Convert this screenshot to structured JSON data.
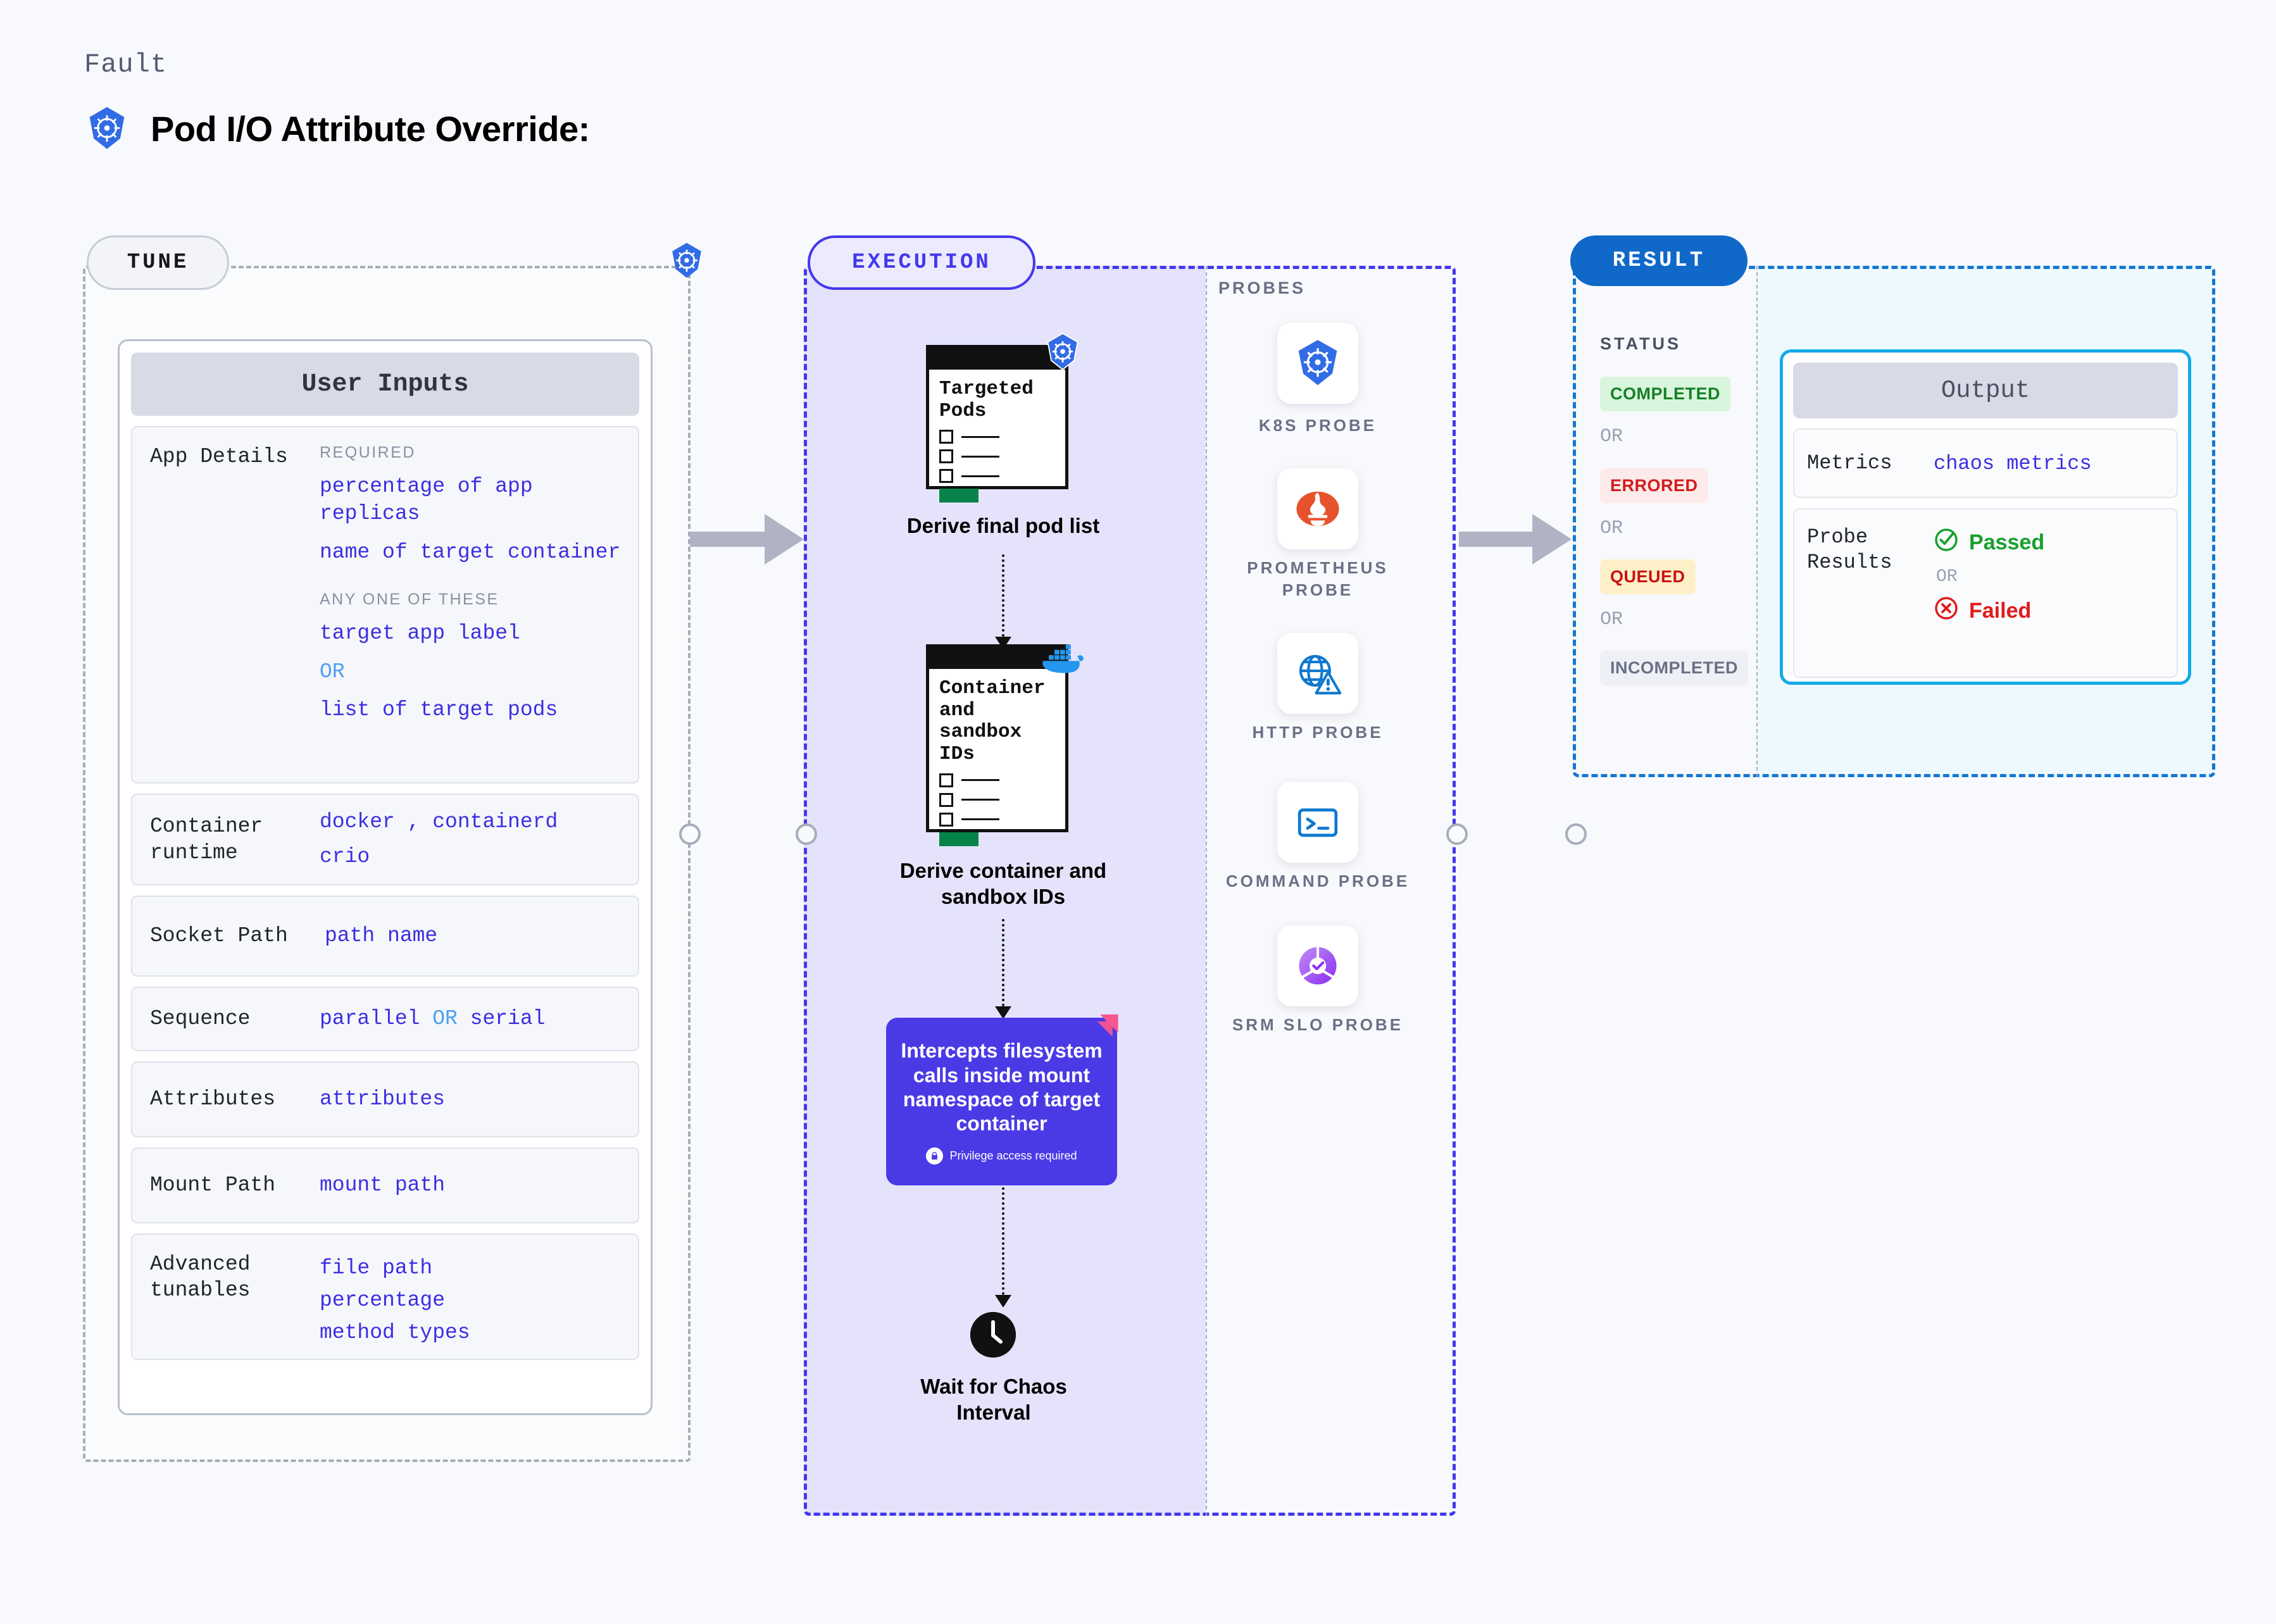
{
  "header": {
    "kicker": "Fault",
    "title": "Pod I/O Attribute Override:",
    "icon": "kubernetes-icon"
  },
  "tune": {
    "pill_label": "TUNE",
    "edge_icon": "kubernetes-icon",
    "card_title": "User Inputs",
    "rows": [
      {
        "label": "App Details",
        "groups": [
          {
            "heading": "REQUIRED",
            "values": [
              "percentage of app replicas",
              "name of target container"
            ]
          },
          {
            "heading": "ANY ONE OF THESE",
            "values": [
              "target app label",
              "OR",
              "list of target pods"
            ]
          }
        ]
      },
      {
        "label": "Container runtime",
        "values": [
          "docker , containerd",
          "crio"
        ]
      },
      {
        "label": "Socket Path",
        "values": [
          "path name"
        ]
      },
      {
        "label": "Sequence",
        "values": [
          "parallel OR serial"
        ]
      },
      {
        "label": "Attributes",
        "values": [
          "attributes"
        ]
      },
      {
        "label": "Mount Path",
        "values": [
          "mount path"
        ]
      },
      {
        "label": "Advanced tunables",
        "values": [
          "file path",
          "percentage",
          "method types"
        ]
      }
    ]
  },
  "execution": {
    "pill_label": "EXECUTION",
    "steps": [
      {
        "doc_title": "Targeted Pods",
        "caption": "Derive final pod list",
        "badge_icon": "kubernetes-icon"
      },
      {
        "doc_title": "Container and sandbox IDs",
        "caption": "Derive container and sandbox IDs",
        "badge_icon": "docker-icon"
      }
    ],
    "intercept": {
      "text": "Intercepts filesystem calls inside mount namespace of target container",
      "note": "Privilege access required",
      "note_icon": "lock-icon",
      "corner_icon": "litmus-icon",
      "bg_color": "#4a3ae6"
    },
    "wait": {
      "caption": "Wait for Chaos Interval",
      "icon": "clock-icon"
    }
  },
  "probes": {
    "section_label": "PROBES",
    "items": [
      {
        "label": "K8S PROBE",
        "icon": "kubernetes-icon"
      },
      {
        "label": "PROMETHEUS PROBE",
        "icon": "prometheus-icon"
      },
      {
        "label": "HTTP PROBE",
        "icon": "http-globe-icon"
      },
      {
        "label": "COMMAND PROBE",
        "icon": "terminal-icon"
      },
      {
        "label": "SRM SLO PROBE",
        "icon": "srm-slo-icon"
      }
    ]
  },
  "result": {
    "pill_label": "RESULT",
    "status_label": "STATUS",
    "or_label": "OR",
    "statuses": [
      {
        "label": "COMPLETED",
        "bg": "#daf5de",
        "fg": "#158024"
      },
      {
        "label": "ERRORED",
        "bg": "#fdeaea",
        "fg": "#d21c1c"
      },
      {
        "label": "QUEUED",
        "bg": "#fdf0c9",
        "fg": "#cc1111"
      },
      {
        "label": "INCOMPLETED",
        "bg": "#eff0f5",
        "fg": "#6a7086"
      }
    ],
    "output": {
      "title": "Output",
      "metrics_label": "Metrics",
      "metrics_value": "chaos metrics",
      "probe_results_label": "Probe Results",
      "passed_label": "Passed",
      "failed_label": "Failed",
      "or_label": "OR",
      "passed_color": "#18a02c",
      "failed_color": "#e01b1b",
      "passed_icon": "check-circle-icon",
      "failed_icon": "x-circle-icon"
    }
  }
}
